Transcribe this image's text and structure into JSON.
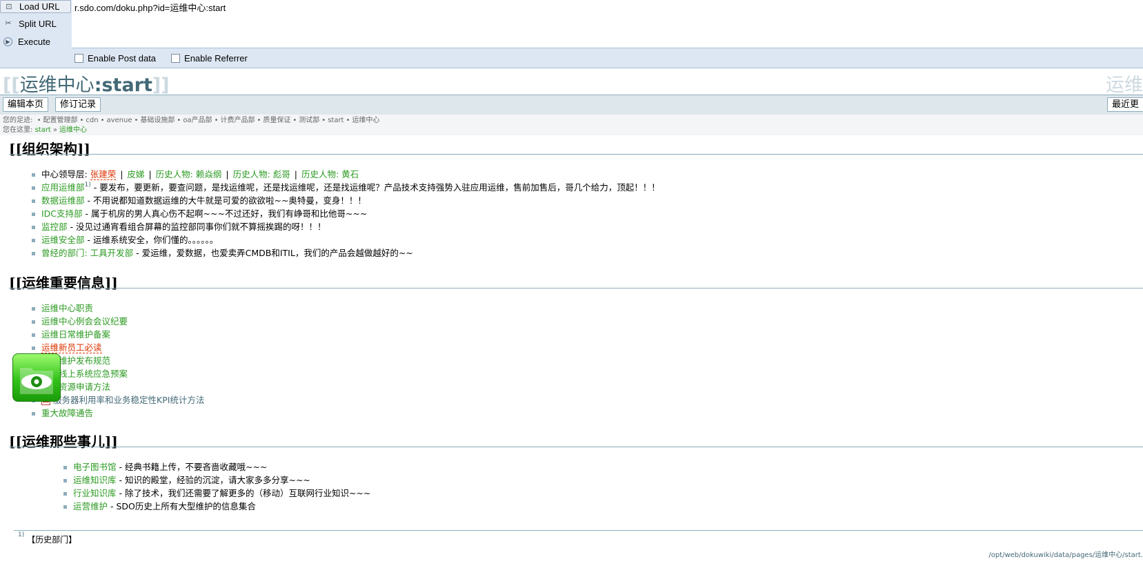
{
  "hackbar": {
    "load_url": "Load URL",
    "split_url": "Split URL",
    "execute": "Execute",
    "url_value": "r.sdo.com/doku.php?id=运维中心:start",
    "enable_post": "Enable Post data",
    "enable_referrer": "Enable Referrer"
  },
  "header": {
    "title_open": "[[",
    "title_ns": "运维中心",
    "title_page": ":start",
    "title_close": "]]",
    "logo_text": "运维"
  },
  "actions": {
    "edit": "编辑本页",
    "revisions": "修订记录",
    "recent": "最近更"
  },
  "trace": {
    "label": "您的足迹:",
    "items": [
      "配置管理部",
      "cdn",
      "avenue",
      "基础设施部",
      "oa产品部",
      "计费产品部",
      "质量保证",
      "测试部",
      "start",
      "运维中心"
    ]
  },
  "youarehere": {
    "label": "您在这里:",
    "items": [
      "start",
      "运维中心"
    ]
  },
  "sections": [
    {
      "heading": "[[组织架构]]",
      "items": [
        {
          "prefix": "中心领导层: ",
          "links": [
            "张建荣",
            "皮娣",
            "历史人物: 赖焱纲",
            "历史人物: 彪哥",
            "历史人物: 黄石"
          ]
        },
        {
          "link": "应用运维部",
          "sup": "1)",
          "desc": " - 要发布，要更新，要查问题，是找运维呢，还是找运维呢，还是找运维呢？产品技术支持强势入驻应用运维，售前加售后，哥几个给力，顶起！！！"
        },
        {
          "link": "数据运维部",
          "desc": " - 不用说都知道数据运维的大牛就是可爱的欲欲啦~~奥特曼，变身！！！"
        },
        {
          "link": "IDC支持部",
          "desc": " - 属于机房的男人真心伤不起啊~~~不过还好，我们有峥哥和比他哥~~~"
        },
        {
          "link": "监控部",
          "desc": " - 没见过通宵看组合屏幕的监控部同事你们就不算摇挨踢的呀！！！"
        },
        {
          "link": "运维安全部",
          "desc": " - 运维系统安全，你们懂的。。。。。。"
        },
        {
          "link": "曾经的部门: 工具开发部",
          "desc": " - 爱运维，爱数据，也爱卖弄CMDB和ITIL，我们的产品会越做越好的~~"
        }
      ]
    },
    {
      "heading": "[[运维重要信息]]",
      "items": [
        {
          "link": "运维中心职责"
        },
        {
          "link": "运维中心例会会议纪要"
        },
        {
          "link": "运维日常维护备案"
        },
        {
          "link": "运维新员工必读",
          "missing": true
        },
        {
          "link": "运营维护发布规范"
        },
        {
          "link": "运维线上系统应急预案"
        },
        {
          "link": "运维资源申请方法"
        },
        {
          "link": "服务器利用率和业务稳定性KPI统计方法",
          "pdf": true
        },
        {
          "link": "重大故障通告"
        }
      ]
    },
    {
      "heading": "[[运维那些事儿]]",
      "items": [
        {
          "link": "电子图书馆",
          "desc": " - 经典书籍上传，不要吝啬收藏哦~~~"
        },
        {
          "link": "运维知识库",
          "desc": " - 知识的殿堂，经验的沉淀，请大家多多分享~~~"
        },
        {
          "link": "行业知识库",
          "desc": " - 除了技术，我们还需要了解更多的（移动）互联网行业知识~~~"
        },
        {
          "link": "运营维护",
          "desc": " - SDO历史上所有大型维护的信息集合"
        }
      ]
    }
  ],
  "footnote": {
    "sup": "1)",
    "text": "【历史部门】"
  },
  "file_path": "/opt/web/dokuwiki/data/pages/运维中心/start.",
  "colors": {
    "link": "#2b9a21",
    "missing_link": "#dd3300",
    "heading_line": "#8cacbb",
    "title": "#436976"
  }
}
